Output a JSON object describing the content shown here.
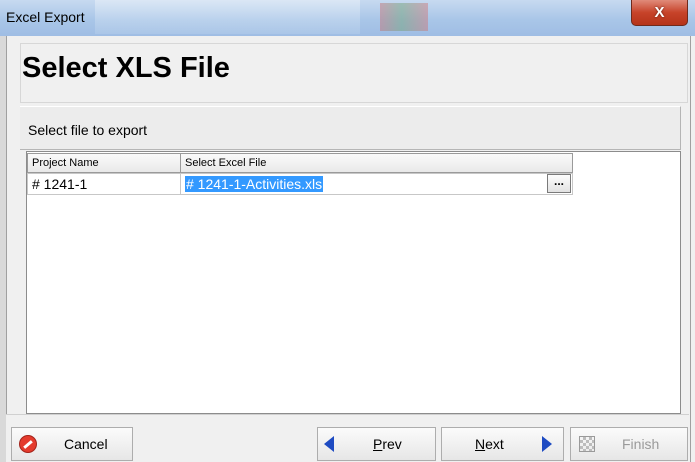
{
  "window": {
    "title": "Excel Export",
    "close_label": "X"
  },
  "page": {
    "title": "Select XLS File",
    "subtitle": "Select file to export"
  },
  "grid": {
    "columns": [
      "Project Name",
      "Select Excel File"
    ],
    "rows": [
      {
        "project_name": "# 1241-1",
        "excel_file": "# 1241-1-Activities.xls",
        "browse_label": "..."
      }
    ]
  },
  "buttons": {
    "cancel": "Cancel",
    "prev_mnemonic": "P",
    "prev_rest": "rev",
    "next_mnemonic": "N",
    "next_rest": "ext",
    "finish": "Finish"
  },
  "colors": {
    "selection": "#3399ff",
    "nav_arrow": "#1e4bc2",
    "cancel_icon": "#e43b2d",
    "close_button": "#c7432a"
  }
}
